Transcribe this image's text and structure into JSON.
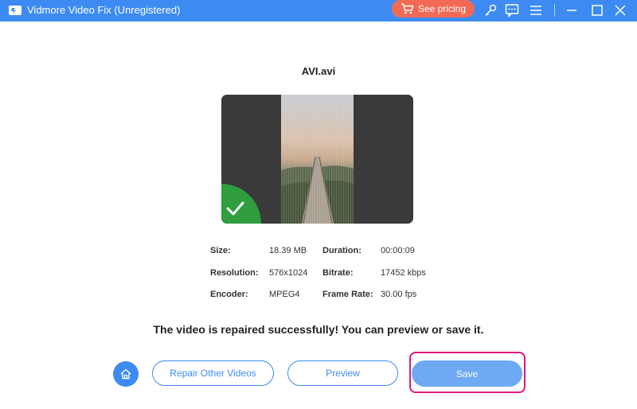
{
  "window": {
    "title": "Vidmore Video Fix (Unregistered)",
    "pricing_label": "See pricing",
    "icons": [
      "app-logo-icon",
      "cart-icon",
      "key-icon",
      "feedback-icon",
      "menu-icon",
      "minimize-icon",
      "maximize-icon",
      "close-icon"
    ]
  },
  "video": {
    "file_name": "AVI.avi"
  },
  "info": {
    "size_label": "Size:",
    "size_value": "18.39 MB",
    "resolution_label": "Resolution:",
    "resolution_value": "576x1024",
    "encoder_label": "Encoder:",
    "encoder_value": "MPEG4",
    "duration_label": "Duration:",
    "duration_value": "00:00:09",
    "bitrate_label": "Bitrate:",
    "bitrate_value": "17452 kbps",
    "framerate_label": "Frame Rate:",
    "framerate_value": "30.00 fps"
  },
  "message": "The video is repaired successfully! You can preview or save it.",
  "actions": {
    "repair_other_label": "Repair Other Videos",
    "preview_label": "Preview",
    "save_label": "Save"
  },
  "colors": {
    "titlebar": "#3d8bf2",
    "pricing": "#f26a55",
    "accent": "#3d8bf2",
    "save": "#6fa9f3",
    "highlight": "#e0197d",
    "success": "#2e9e3e"
  }
}
